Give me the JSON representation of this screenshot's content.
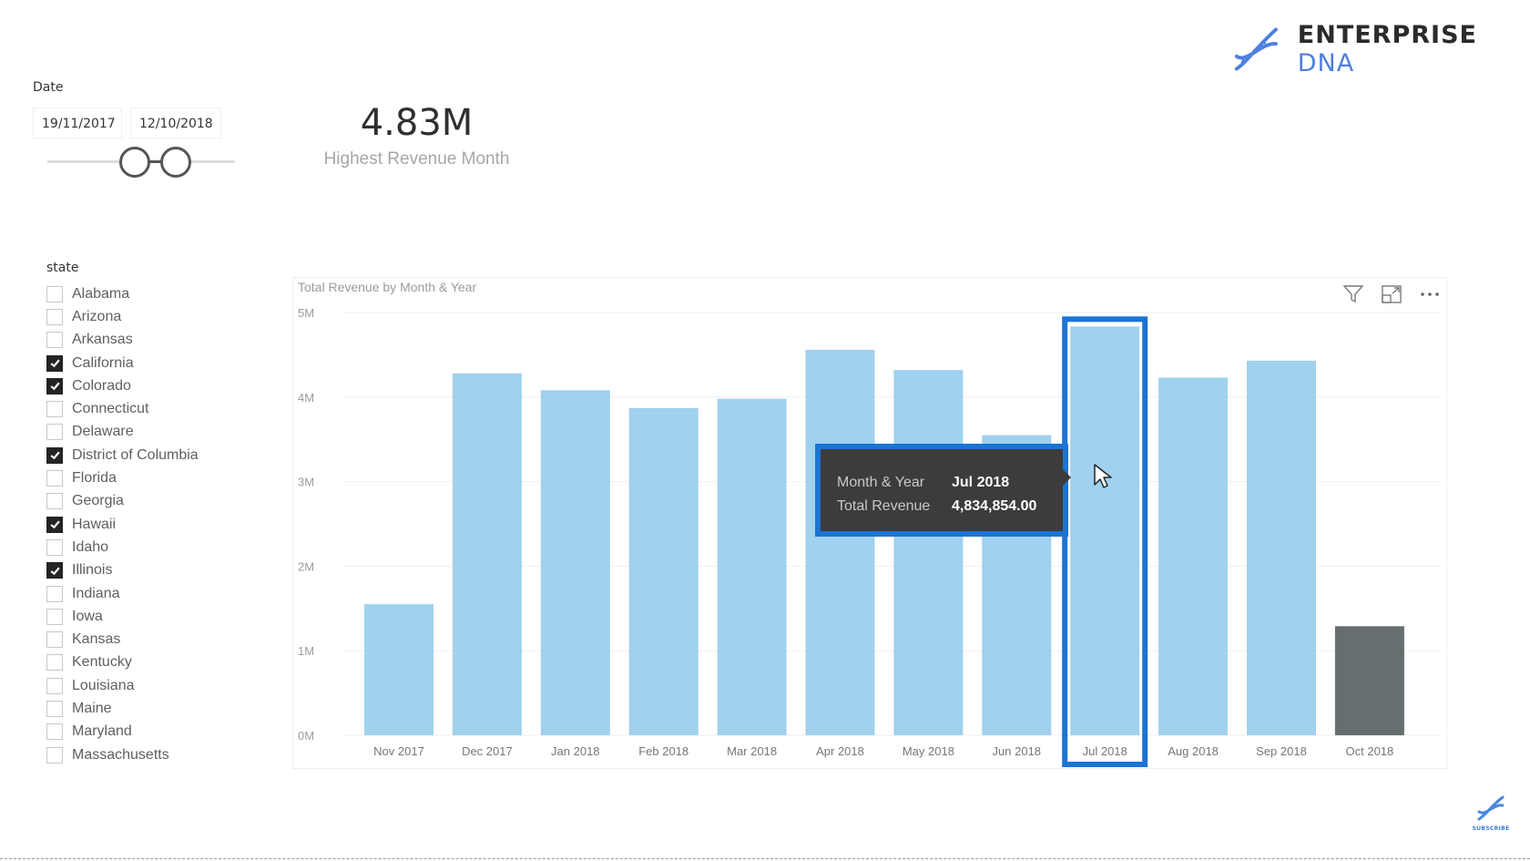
{
  "logo": {
    "name_bold": "ENTERPRISE",
    "name_light": "DNA",
    "icon": "dna-icon"
  },
  "date_slicer": {
    "label": "Date",
    "start": "19/11/2017",
    "end": "12/10/2018"
  },
  "card": {
    "value": "4.83M",
    "label": "Highest Revenue Month"
  },
  "state_slicer": {
    "title": "state",
    "items": [
      {
        "label": "Alabama",
        "checked": false
      },
      {
        "label": "Arizona",
        "checked": false
      },
      {
        "label": "Arkansas",
        "checked": false
      },
      {
        "label": "California",
        "checked": true
      },
      {
        "label": "Colorado",
        "checked": true
      },
      {
        "label": "Connecticut",
        "checked": false
      },
      {
        "label": "Delaware",
        "checked": false
      },
      {
        "label": "District of Columbia",
        "checked": true
      },
      {
        "label": "Florida",
        "checked": false
      },
      {
        "label": "Georgia",
        "checked": false
      },
      {
        "label": "Hawaii",
        "checked": true
      },
      {
        "label": "Idaho",
        "checked": false
      },
      {
        "label": "Illinois",
        "checked": true
      },
      {
        "label": "Indiana",
        "checked": false
      },
      {
        "label": "Iowa",
        "checked": false
      },
      {
        "label": "Kansas",
        "checked": false
      },
      {
        "label": "Kentucky",
        "checked": false
      },
      {
        "label": "Louisiana",
        "checked": false
      },
      {
        "label": "Maine",
        "checked": false
      },
      {
        "label": "Maryland",
        "checked": false
      },
      {
        "label": "Massachusetts",
        "checked": false
      }
    ]
  },
  "visual_header": {
    "icons": [
      "filter-icon",
      "focus-mode-icon",
      "more-options-icon"
    ]
  },
  "tooltip": {
    "rows": [
      {
        "key": "Month & Year",
        "value": "Jul 2018"
      },
      {
        "key": "Total Revenue",
        "value": "4,834,854.00"
      }
    ]
  },
  "subscribe": {
    "label": "SUBSCRIBE"
  },
  "colors": {
    "bar": "#a0d1ee",
    "bar_last": "#666e70",
    "highlight": "#1b74d3",
    "logo_accent": "#4f7fdf"
  },
  "chart_data": {
    "type": "bar",
    "title": "Total Revenue by Month & Year",
    "xlabel": "",
    "ylabel": "",
    "categories": [
      "Nov 2017",
      "Dec 2017",
      "Jan 2018",
      "Feb 2018",
      "Mar 2018",
      "Apr 2018",
      "May 2018",
      "Jun 2018",
      "Jul 2018",
      "Aug 2018",
      "Sep 2018",
      "Oct 2018"
    ],
    "values": [
      1550000,
      4280000,
      4080000,
      3870000,
      3980000,
      4560000,
      4320000,
      3550000,
      4834854,
      4230000,
      4430000,
      1290000
    ],
    "ylim": [
      0,
      5000000
    ],
    "yticks": [
      0,
      1000000,
      2000000,
      3000000,
      4000000,
      5000000
    ],
    "ytick_labels": [
      "0M",
      "1M",
      "2M",
      "3M",
      "4M",
      "5M"
    ],
    "grid": true,
    "legend": "none",
    "highlighted_category": "Jul 2018",
    "dark_category": "Oct 2018"
  }
}
